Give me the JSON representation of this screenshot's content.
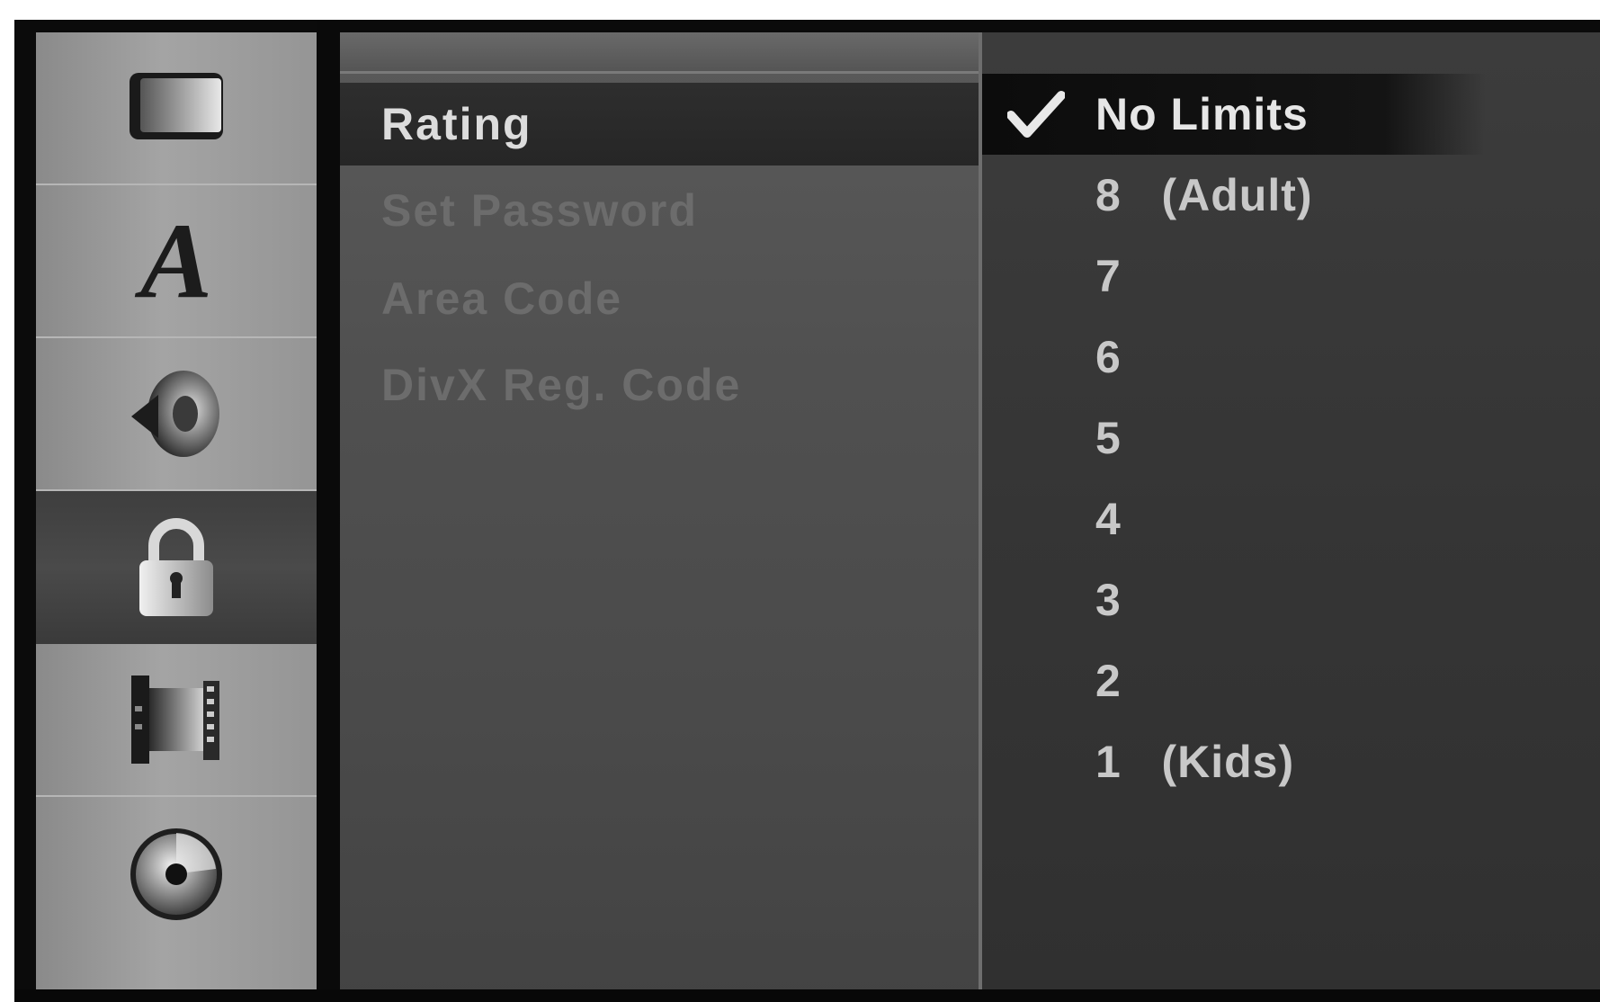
{
  "sidebar": {
    "items": [
      {
        "icon": "display-icon",
        "active": false
      },
      {
        "icon": "language-icon",
        "glyph": "A",
        "active": false
      },
      {
        "icon": "speaker-icon",
        "active": false
      },
      {
        "icon": "lock-icon",
        "active": true
      },
      {
        "icon": "film-icon",
        "active": false
      },
      {
        "icon": "disc-icon",
        "active": false
      }
    ]
  },
  "menu": {
    "items": [
      {
        "label": "Rating",
        "selected": true
      },
      {
        "label": "Set Password",
        "selected": false
      },
      {
        "label": "Area Code",
        "selected": false
      },
      {
        "label": "DivX Reg. Code",
        "selected": false
      }
    ]
  },
  "options": {
    "items": [
      {
        "label": "No Limits",
        "checked": true
      },
      {
        "label": "8   (Adult)",
        "checked": false
      },
      {
        "label": "7",
        "checked": false
      },
      {
        "label": "6",
        "checked": false
      },
      {
        "label": "5",
        "checked": false
      },
      {
        "label": "4",
        "checked": false
      },
      {
        "label": "3",
        "checked": false
      },
      {
        "label": "2",
        "checked": false
      },
      {
        "label": "1   (Kids)",
        "checked": false
      }
    ]
  }
}
